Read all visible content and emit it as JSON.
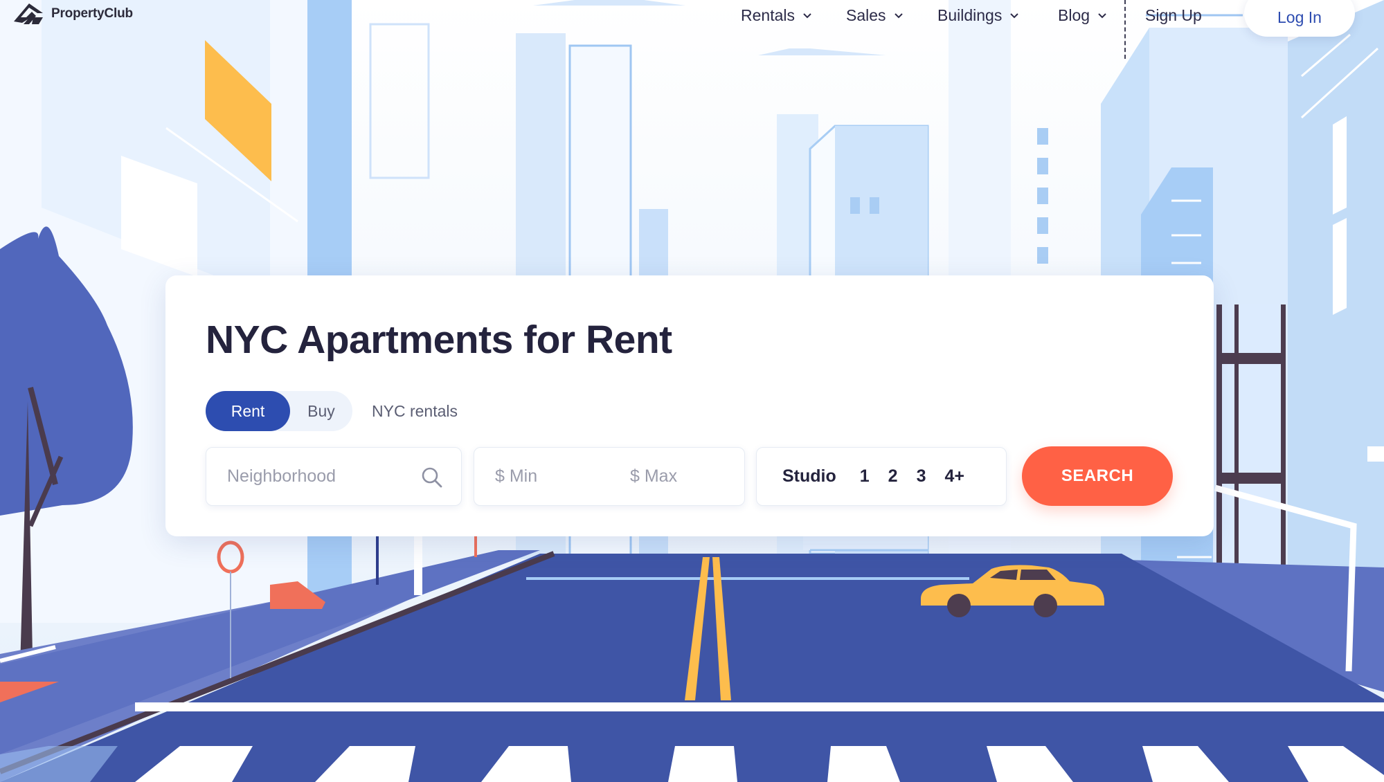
{
  "brand": {
    "name": "PropertyClub"
  },
  "nav": {
    "items": [
      {
        "label": "Rentals"
      },
      {
        "label": "Sales"
      },
      {
        "label": "Buildings"
      },
      {
        "label": "Blog"
      }
    ],
    "signup_label": "Sign Up",
    "login_label": "Log In"
  },
  "search": {
    "title": "NYC Apartments for Rent",
    "tabs": {
      "rent": "Rent",
      "buy": "Buy",
      "selected": "Rent"
    },
    "breadcrumb": "NYC rentals",
    "neighborhood_placeholder": "Neighborhood",
    "min_placeholder": "$ Min",
    "max_placeholder": "$ Max",
    "bedrooms": [
      "Studio",
      "1",
      "2",
      "3",
      "4+"
    ],
    "button_label": "SEARCH"
  },
  "colors": {
    "brand_blue": "#2d4db0",
    "search_orange": "#ff6145",
    "road": "#3f55a6",
    "taxi": "#fdbd4d"
  },
  "icons": [
    "logo-icon",
    "chevron-down-icon",
    "search-icon"
  ]
}
